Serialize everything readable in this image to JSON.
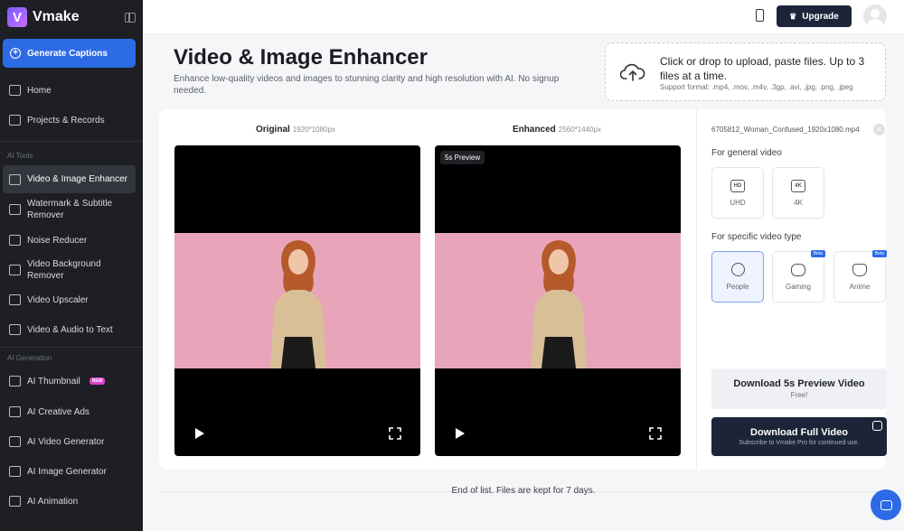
{
  "app": {
    "name": "Vmake"
  },
  "sidebar": {
    "generate_label": "Generate Captions",
    "nav_top": [
      {
        "label": "Home",
        "icon": "home-icon"
      },
      {
        "label": "Projects & Records",
        "icon": "projects-icon"
      }
    ],
    "ai_tools_label": "AI Tools",
    "ai_tools": [
      {
        "label": "Video & Image Enhancer",
        "icon": "hd-icon",
        "active": true
      },
      {
        "label": "Watermark & Subtitle Remover",
        "icon": "eraser-icon"
      },
      {
        "label": "Noise Reducer",
        "icon": "noise-icon"
      },
      {
        "label": "Video Background Remover",
        "icon": "background-remover-icon"
      },
      {
        "label": "Video Upscaler",
        "icon": "upscaler-icon"
      },
      {
        "label": "Video & Audio to Text",
        "icon": "transcribe-icon"
      }
    ],
    "ai_generation_label": "AI Generation",
    "ai_generation": [
      {
        "label": "AI Thumbnail",
        "icon": "thumbnail-icon",
        "badge": "NEW"
      },
      {
        "label": "AI Creative Ads",
        "icon": "ads-icon"
      },
      {
        "label": "AI Video Generator",
        "icon": "video-generator-icon"
      },
      {
        "label": "AI Image Generator",
        "icon": "image-generator-icon"
      },
      {
        "label": "AI Animation",
        "icon": "animation-icon"
      }
    ]
  },
  "topbar": {
    "upgrade_label": "Upgrade"
  },
  "header": {
    "title": "Video & Image Enhancer",
    "description": "Enhance low-quality videos and images to stunning clarity and high resolution with AI. No signup needed."
  },
  "upload": {
    "main_text": "Click or drop to upload, paste files. Up to 3 files at a time.",
    "formats": "Support format: .mp4, .mov, .m4v, .3gp, .avi, .jpg, .png, .jpeg"
  },
  "preview": {
    "original": {
      "label": "Original",
      "resolution": "1920*1080px"
    },
    "enhanced": {
      "label": "Enhanced",
      "resolution": "2560*1440px",
      "tag": "5s Preview"
    }
  },
  "settings": {
    "file_name": "6705812_Woman_Confused_1920x1080.mp4",
    "general_title": "For general video",
    "general_options": [
      {
        "label": "UHD",
        "icon_text": "HD"
      },
      {
        "label": "4K",
        "icon_text": "4K"
      }
    ],
    "specific_title": "For specific video type",
    "specific_options": [
      {
        "label": "People",
        "selected": true
      },
      {
        "label": "Gaming",
        "badge": "Beta"
      },
      {
        "label": "Anime",
        "badge": "Beta"
      }
    ],
    "download_preview": {
      "label": "Download 5s Preview Video",
      "sub": "Free!"
    },
    "download_full": {
      "label": "Download Full Video",
      "sub": "Subscribe to Vmake Pro for continued use."
    }
  },
  "footer": {
    "note": "End of list. Files are kept for 7 days."
  },
  "colors": {
    "primary": "#2d6be6",
    "sidebar_bg": "#1d1f24",
    "dark_button": "#1c2538",
    "video_bg": "#e8a4b8"
  }
}
